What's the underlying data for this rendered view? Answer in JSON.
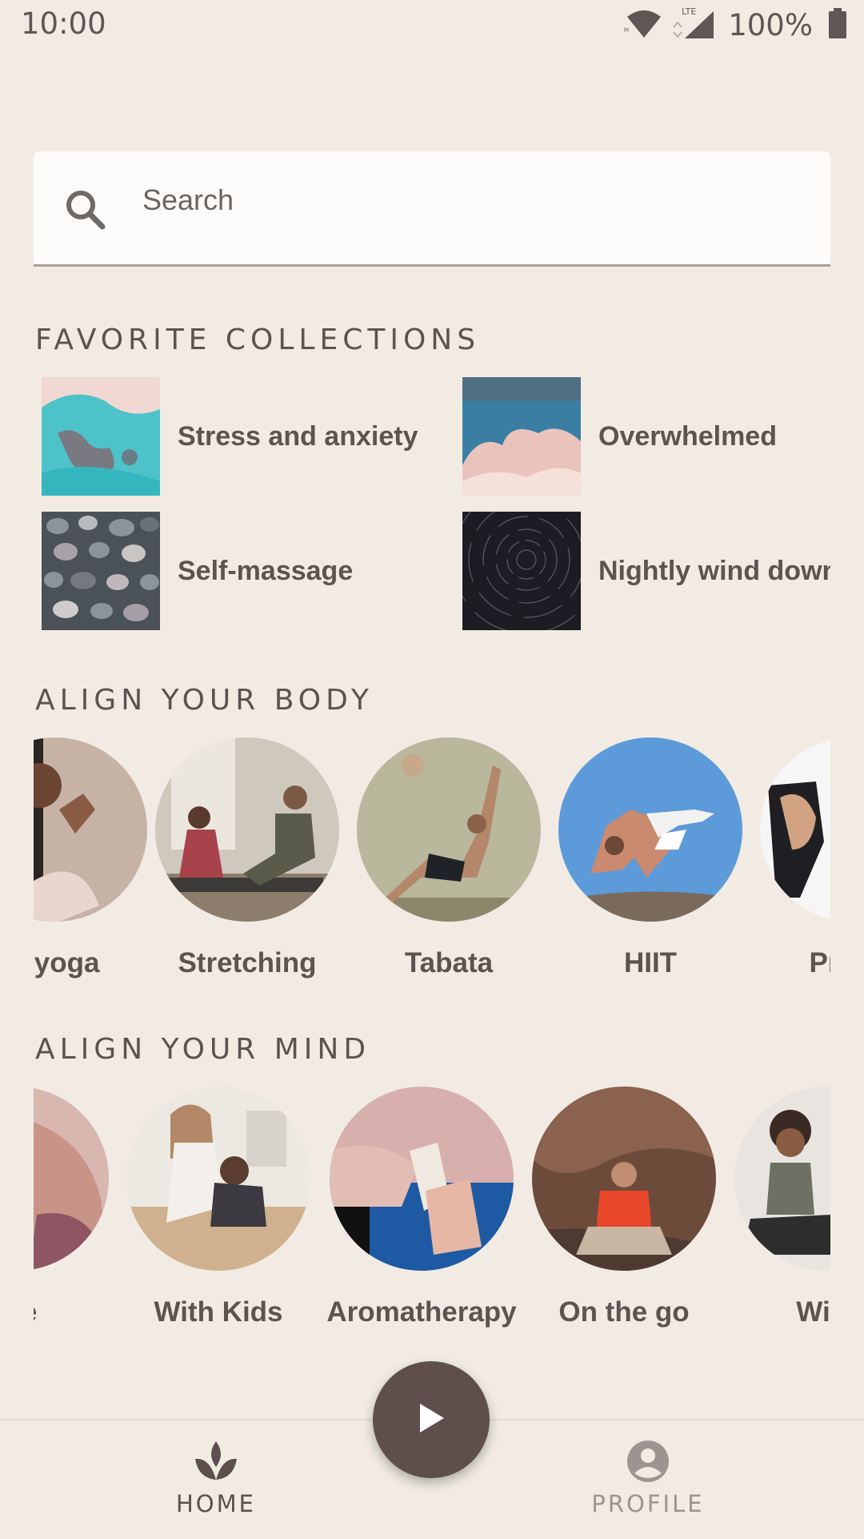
{
  "status_bar": {
    "time": "10:00",
    "network": "LTE",
    "battery": "100%",
    "icons": [
      "wifi-icon",
      "cell-signal-icon",
      "battery-icon"
    ]
  },
  "search": {
    "placeholder": "Search",
    "icon": "search-icon"
  },
  "favorite_collections": {
    "title": "FAVORITE COLLECTIONS",
    "items": [
      {
        "label": "Stress and anxiety",
        "image": "turquoise-water-aerial"
      },
      {
        "label": "Overwhelmed",
        "image": "pink-clouds-sky"
      },
      {
        "label": "Self-massage",
        "image": "pebbles"
      },
      {
        "label": "Nightly wind down",
        "image": "star-trails-night"
      }
    ]
  },
  "align_body": {
    "title": "ALIGN YOUR BODY",
    "items": [
      {
        "label": "Inversions / Quick yoga",
        "caption": "k yoga"
      },
      {
        "label": "Stretching",
        "caption": "Stretching"
      },
      {
        "label": "Tabata",
        "caption": "Tabata"
      },
      {
        "label": "HIIT",
        "caption": "HIIT"
      },
      {
        "label": "Pre natal",
        "caption": "Pre na"
      }
    ]
  },
  "align_mind": {
    "title": "ALIGN YOUR MIND",
    "items": [
      {
        "label": "Meditate",
        "caption": "ate"
      },
      {
        "label": "With Kids",
        "caption": "With Kids"
      },
      {
        "label": "Aromatherapy",
        "caption": "Aromatherapy"
      },
      {
        "label": "On the go",
        "caption": "On the go"
      },
      {
        "label": "With",
        "caption": "With"
      }
    ]
  },
  "bottom_nav": {
    "home": "HOME",
    "profile": "PROFILE"
  },
  "colors": {
    "background": "#f1ebe4",
    "accent": "#5e4f4d",
    "inactive": "#9c9491"
  }
}
